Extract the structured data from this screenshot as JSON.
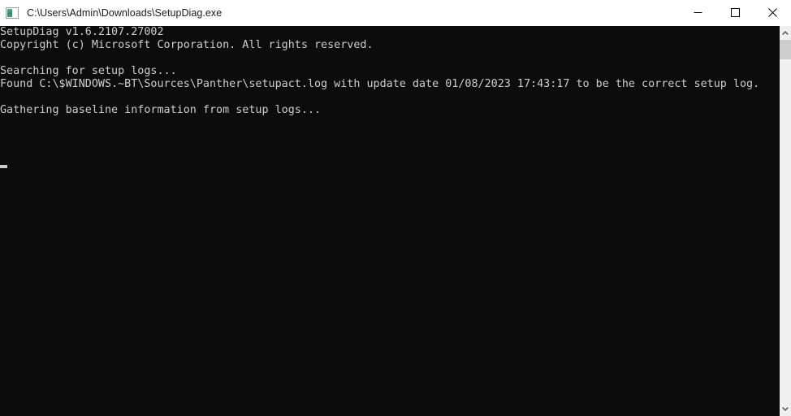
{
  "window": {
    "title": "C:\\Users\\Admin\\Downloads\\SetupDiag.exe",
    "icon": "console-app-icon",
    "background_color": "#0c0c0c",
    "titlebar_color": "#ffffff",
    "text_color": "#cccccc"
  },
  "controls": {
    "minimize_label": "Minimize",
    "maximize_label": "Maximize",
    "close_label": "Close"
  },
  "console": {
    "lines": [
      "SetupDiag v1.6.2107.27002",
      "Copyright (c) Microsoft Corporation. All rights reserved.",
      "",
      "Searching for setup logs...",
      "Found C:\\$WINDOWS.~BT\\Sources\\Panther\\setupact.log with update date 01/08/2023 17:43:17 to be the correct setup log.",
      "",
      "Gathering baseline information from setup logs..."
    ],
    "cursor_visible": true,
    "details": {
      "program_name": "SetupDiag",
      "version": "v1.6.2107.27002",
      "copyright": "Copyright (c) Microsoft Corporation. All rights reserved.",
      "log_path": "C:\\$WINDOWS.~BT\\Sources\\Panther\\setupact.log",
      "log_update_date": "01/08/2023",
      "log_update_time": "17:43:17"
    }
  },
  "scrollbar": {
    "up_arrow": "scroll-up",
    "down_arrow": "scroll-down",
    "thumb_position": "top"
  }
}
